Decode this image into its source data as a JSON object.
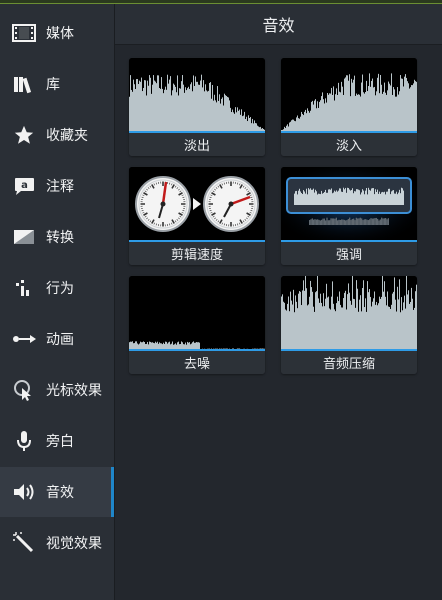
{
  "sidebar": {
    "items": [
      {
        "label": "媒体",
        "icon": "film-icon"
      },
      {
        "label": "库",
        "icon": "library-books-icon"
      },
      {
        "label": "收藏夹",
        "icon": "star-icon"
      },
      {
        "label": "注释",
        "icon": "annotation-callout-icon"
      },
      {
        "label": "转换",
        "icon": "transition-icon"
      },
      {
        "label": "行为",
        "icon": "behavior-icon"
      },
      {
        "label": "动画",
        "icon": "animation-arrow-icon"
      },
      {
        "label": "光标效果",
        "icon": "cursor-effect-icon"
      },
      {
        "label": "旁白",
        "icon": "microphone-icon"
      },
      {
        "label": "音效",
        "icon": "speaker-icon",
        "active": true
      },
      {
        "label": "视觉效果",
        "icon": "magic-wand-icon"
      }
    ]
  },
  "main": {
    "title": "音效",
    "tiles": [
      {
        "label": "淡出",
        "thumb": "fade-out-waveform"
      },
      {
        "label": "淡入",
        "thumb": "fade-in-waveform"
      },
      {
        "label": "剪辑速度",
        "thumb": "clip-speed-clocks"
      },
      {
        "label": "强调",
        "thumb": "emphasize-waveform"
      },
      {
        "label": "去噪",
        "thumb": "noise-removal-waveform"
      },
      {
        "label": "音频压缩",
        "thumb": "audio-compression-waveform"
      }
    ]
  },
  "colors": {
    "accent": "#2e9be6",
    "sidebar_bg": "#2a2f36",
    "main_bg": "#23272d",
    "waveform": "#b9c4c9",
    "top_line": "#6b8f33"
  }
}
